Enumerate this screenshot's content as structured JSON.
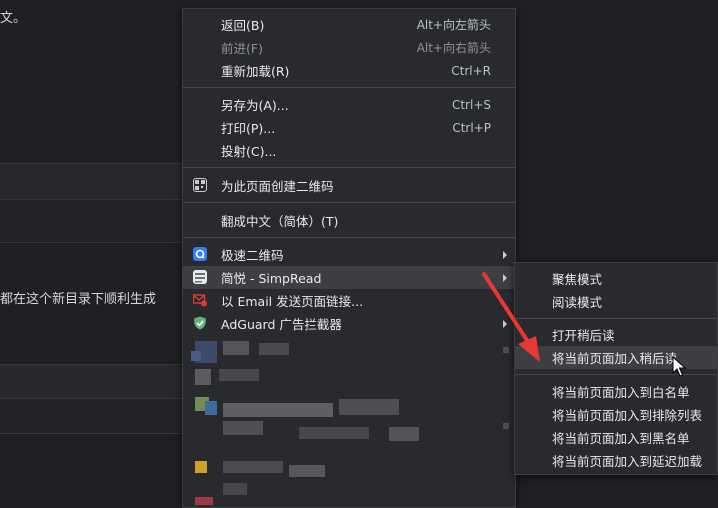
{
  "background": {
    "text_top": "文。",
    "text_mid": "都在这个新目录下顺利生成"
  },
  "menu": {
    "items": [
      {
        "label": "返回(B)",
        "shortcut": "Alt+向左箭头"
      },
      {
        "label": "前进(F)",
        "shortcut": "Alt+向右箭头"
      },
      {
        "label": "重新加载(R)",
        "shortcut": "Ctrl+R"
      },
      {
        "label": "另存为(A)...",
        "shortcut": "Ctrl+S"
      },
      {
        "label": "打印(P)...",
        "shortcut": "Ctrl+P"
      },
      {
        "label": "投射(C)..."
      },
      {
        "label": "为此页面创建二维码"
      },
      {
        "label": "翻成中文（简体）(T)"
      },
      {
        "label": "极速二维码"
      },
      {
        "label": "简悦 - SimpRead"
      },
      {
        "label": "以 Email 发送页面链接..."
      },
      {
        "label": "AdGuard 广告拦截器"
      }
    ]
  },
  "submenu": {
    "items": [
      {
        "label": "聚焦模式"
      },
      {
        "label": "阅读模式"
      },
      {
        "label": "打开稍后读"
      },
      {
        "label": "将当前页面加入稍后读"
      },
      {
        "label": "将当前页面加入到白名单"
      },
      {
        "label": "将当前页面加入到排除列表"
      },
      {
        "label": "将当前页面加入到黑名单"
      },
      {
        "label": "将当前页面加入到延迟加载"
      }
    ]
  },
  "colors": {
    "accent_red": "#e53935",
    "menu_bg": "#292a2d",
    "hover_bg": "#3d3f43"
  }
}
